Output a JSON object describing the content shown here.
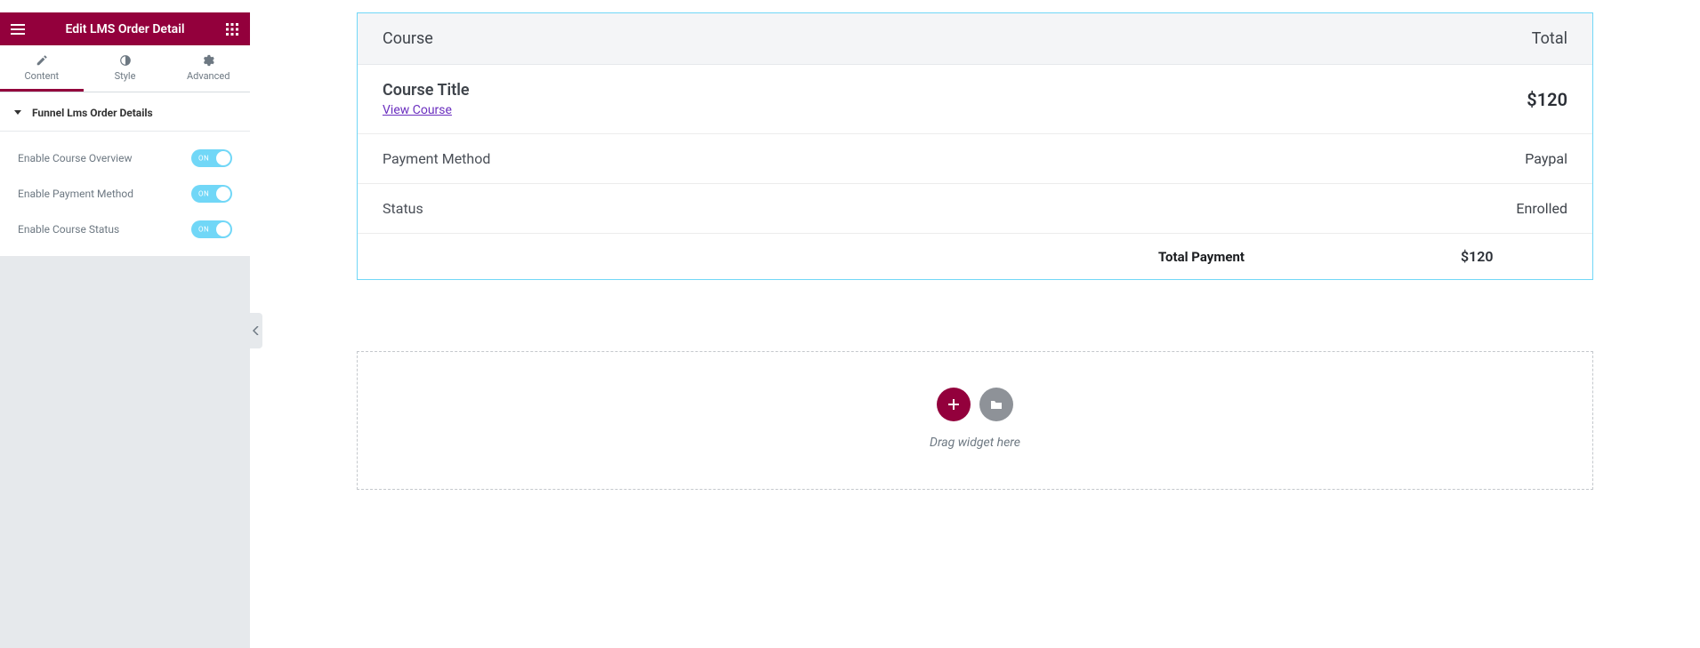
{
  "sidebar": {
    "header_title": "Edit LMS Order Detail",
    "tabs": {
      "content": "Content",
      "style": "Style",
      "advanced": "Advanced"
    },
    "section_title": "Funnel Lms Order Details",
    "controls": {
      "course_overview": {
        "label": "Enable Course Overview",
        "state": "ON"
      },
      "payment_method": {
        "label": "Enable Payment Method",
        "state": "ON"
      },
      "course_status": {
        "label": "Enable Course Status",
        "state": "ON"
      }
    }
  },
  "order": {
    "header_left": "Course",
    "header_right": "Total",
    "course_title": "Course Title",
    "view_course": "View Course",
    "price": "$120",
    "payment_method_label": "Payment Method",
    "payment_method_value": "Paypal",
    "status_label": "Status",
    "status_value": "Enrolled",
    "total_label": "Total Payment",
    "total_value": "$120"
  },
  "dropzone": {
    "text": "Drag widget here"
  }
}
